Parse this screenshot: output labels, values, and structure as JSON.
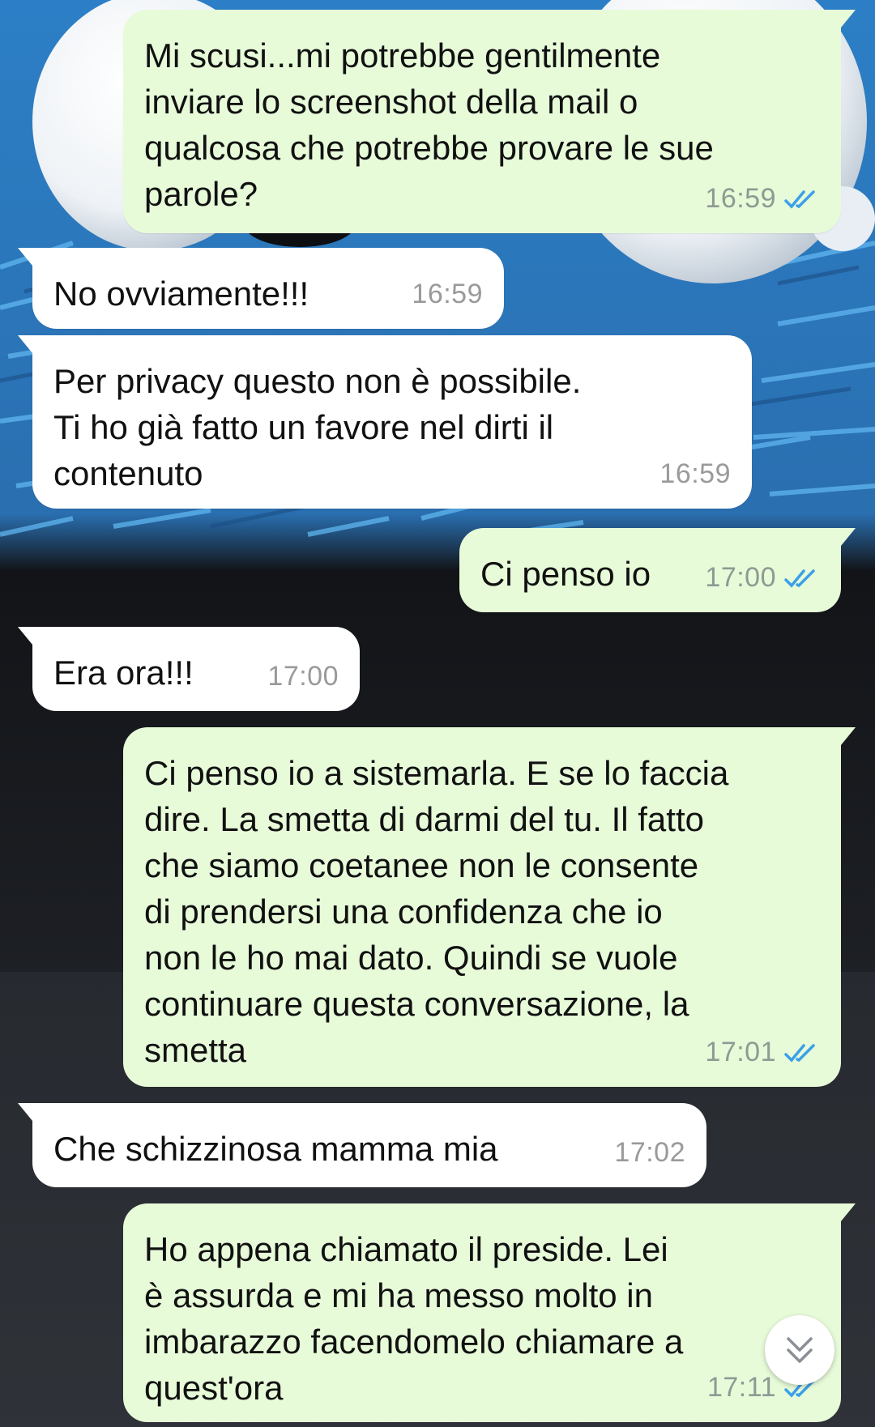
{
  "messages": [
    {
      "direction": "out",
      "text": "Mi scusi...mi potrebbe gentilmente\ninviare lo screenshot della mail o\nqualcosa che potrebbe provare le sue\nparole?",
      "time": "16:59",
      "status": "read"
    },
    {
      "direction": "in",
      "text": "No ovviamente!!!",
      "time": "16:59"
    },
    {
      "direction": "in",
      "text": "Per privacy questo non è possibile.\nTi ho già fatto un favore nel dirti il\ncontenuto",
      "time": "16:59"
    },
    {
      "direction": "out",
      "text": "Ci penso io",
      "time": "17:00",
      "status": "read"
    },
    {
      "direction": "in",
      "text": "Era ora!!!",
      "time": "17:00"
    },
    {
      "direction": "out",
      "text": "Ci penso io a sistemarla. E se lo faccia\ndire. La smetta di darmi del tu. Il fatto\nche siamo coetanee non le consente\ndi prendersi una confidenza che io\nnon le ho mai dato. Quindi se vuole\ncontinuare questa conversazione, la\nsmetta",
      "time": "17:01",
      "status": "read"
    },
    {
      "direction": "in",
      "text": "Che schizzinosa mamma mia",
      "time": "17:02"
    },
    {
      "direction": "out",
      "text": "Ho appena chiamato il preside. Lei\nè assurda e mi ha messo molto in\nimbarazzo facendomelo chiamare a\nquest'ora",
      "time": "17:11",
      "status": "read"
    }
  ],
  "scroll_button": {
    "icon": "double-chevron-down-icon"
  },
  "colors": {
    "outgoing_bubble": "#e7fbd9",
    "incoming_bubble": "#ffffff",
    "read_ticks": "#3ba0e8",
    "timestamp": "#8e9a93",
    "wallpaper_fur": "#2f8fd8"
  }
}
